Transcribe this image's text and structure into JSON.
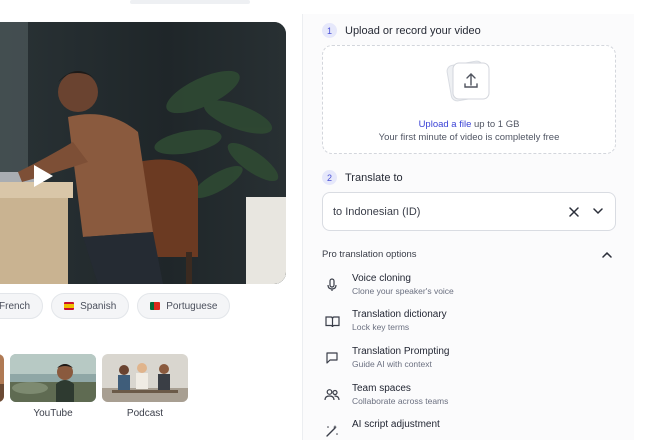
{
  "colors": {
    "accent": "#3b43d6",
    "step_badge_bg": "#e6e8fb",
    "panel_bg": "#fbfbfc",
    "border": "#d9dce2"
  },
  "video": {
    "play_icon": "play-icon"
  },
  "languages": [
    {
      "label": "French",
      "flag": ""
    },
    {
      "label": "Spanish",
      "flag": "spain-flag"
    },
    {
      "label": "Portuguese",
      "flag": "portugal-flag"
    }
  ],
  "thumbnails": [
    {
      "label": "YouTube"
    },
    {
      "label": "Podcast"
    }
  ],
  "steps": {
    "upload": {
      "number": "1",
      "title": "Upload or record your video"
    },
    "translate": {
      "number": "2",
      "title": "Translate to"
    }
  },
  "dropzone": {
    "link_text": "Upload a file",
    "limit_text": " up to 1 GB",
    "note": "Your first minute of video is completely free",
    "icon": "upload-icon"
  },
  "language_select": {
    "value": "to Indonesian (ID)",
    "clear_icon": "close-icon",
    "expand_icon": "chevron-down-icon"
  },
  "pro_options": {
    "title": "Pro translation options",
    "toggle_icon": "chevron-up-icon",
    "items": [
      {
        "title": "Voice cloning",
        "subtitle": "Clone your speaker's voice",
        "icon": "microphone-icon"
      },
      {
        "title": "Translation dictionary",
        "subtitle": "Lock key terms",
        "icon": "book-icon"
      },
      {
        "title": "Translation Prompting",
        "subtitle": "Guide AI with context",
        "icon": "chat-bubble-icon"
      },
      {
        "title": "Team spaces",
        "subtitle": "Collaborate across teams",
        "icon": "team-icon"
      },
      {
        "title": "AI script adjustment",
        "subtitle": "",
        "icon": "magic-wand-icon"
      }
    ]
  }
}
